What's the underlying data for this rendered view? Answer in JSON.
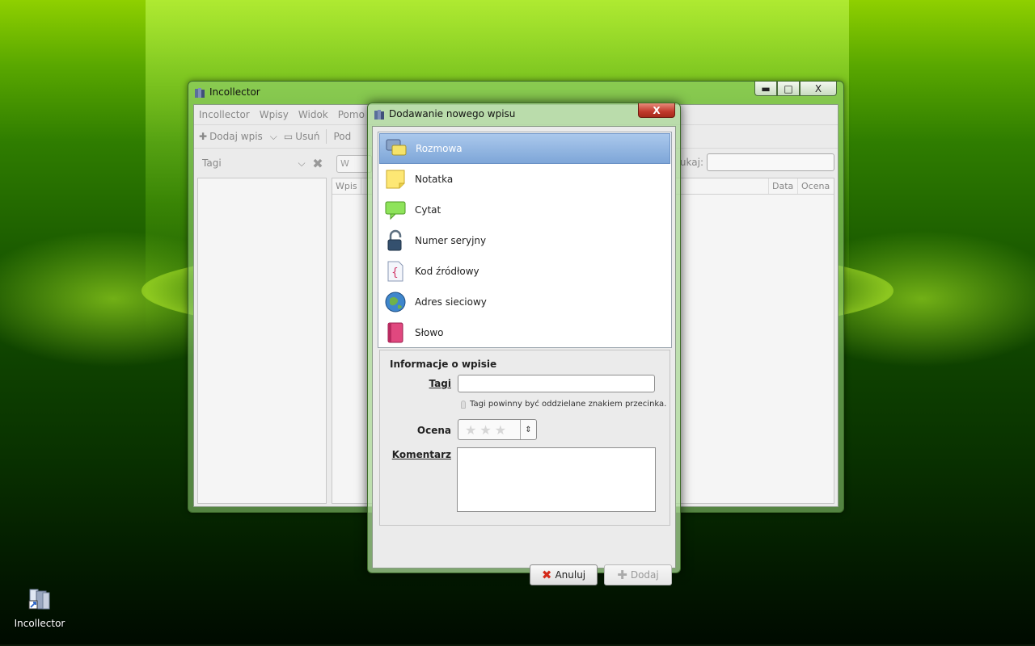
{
  "main_window": {
    "title": "Incollector",
    "controls": {
      "minimize": "▬",
      "maximize": "□",
      "close": "X"
    },
    "menu": [
      "Incollector",
      "Wpisy",
      "Widok",
      "Pomo"
    ],
    "toolbar": {
      "add_entry": "Dodaj wpis",
      "remove": "Usuń",
      "next": "Pod"
    },
    "tags_filter_label": "Tagi",
    "view_button": "W",
    "search_label": "ukaj:",
    "list_columns": {
      "entry": "Wpis",
      "date": "Data",
      "rating": "Ocena"
    }
  },
  "dialog": {
    "title": "Dodawanie nowego wpisu",
    "close": "X",
    "entry_types": [
      {
        "label": "Rozmowa",
        "icon": "chat-bubbles-icon",
        "selected": true
      },
      {
        "label": "Notatka",
        "icon": "sticky-note-icon",
        "selected": false
      },
      {
        "label": "Cytat",
        "icon": "quote-bubble-icon",
        "selected": false
      },
      {
        "label": "Numer seryjny",
        "icon": "padlock-icon",
        "selected": false
      },
      {
        "label": "Kod źródłowy",
        "icon": "source-code-icon",
        "selected": false
      },
      {
        "label": "Adres sieciowy",
        "icon": "globe-icon",
        "selected": false
      },
      {
        "label": "Słowo",
        "icon": "book-icon",
        "selected": false
      }
    ],
    "info": {
      "title": "Informacje o wpisie",
      "tags_label": "Tagi",
      "tags_value": "",
      "tags_hint": "Tagi powinny być oddzielane znakiem przecinka.",
      "rating_label": "Ocena",
      "rating_value": 0,
      "rating_max": 3,
      "comment_label": "Komentarz",
      "comment_value": ""
    },
    "buttons": {
      "cancel": "Anuluj",
      "add": "Dodaj"
    }
  },
  "desktop": {
    "icon_label": "Incollector"
  },
  "colors": {
    "selection": "#7ea6d8",
    "cancel_x": "#d42a1a",
    "close_button": "#c0392b"
  }
}
